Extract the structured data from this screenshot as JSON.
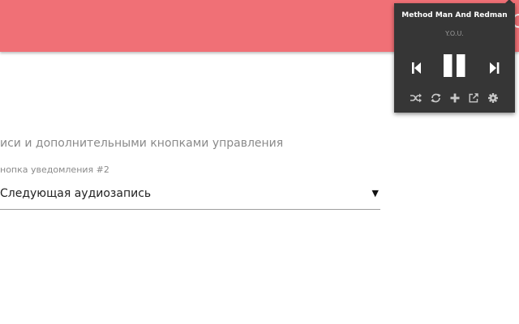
{
  "header": {
    "edge_glyph": "C",
    "color": "#f07076"
  },
  "settings": {
    "section_caption": "иси и дополнительными кнопками управления",
    "field_label": "нопка уведомления #2",
    "select_value": "Следующая аудиозапись",
    "select_arrow": "▼"
  },
  "player": {
    "artist": "Method Man And Redman",
    "track": "Y.O.U.",
    "background": "#363636",
    "icons": {
      "previous": "skip-previous-icon",
      "pause": "pause-icon",
      "next": "skip-next-icon",
      "shuffle": "shuffle-icon",
      "repeat": "repeat-icon",
      "add": "plus-icon",
      "open_external": "external-link-icon",
      "settings": "gear-icon"
    }
  }
}
